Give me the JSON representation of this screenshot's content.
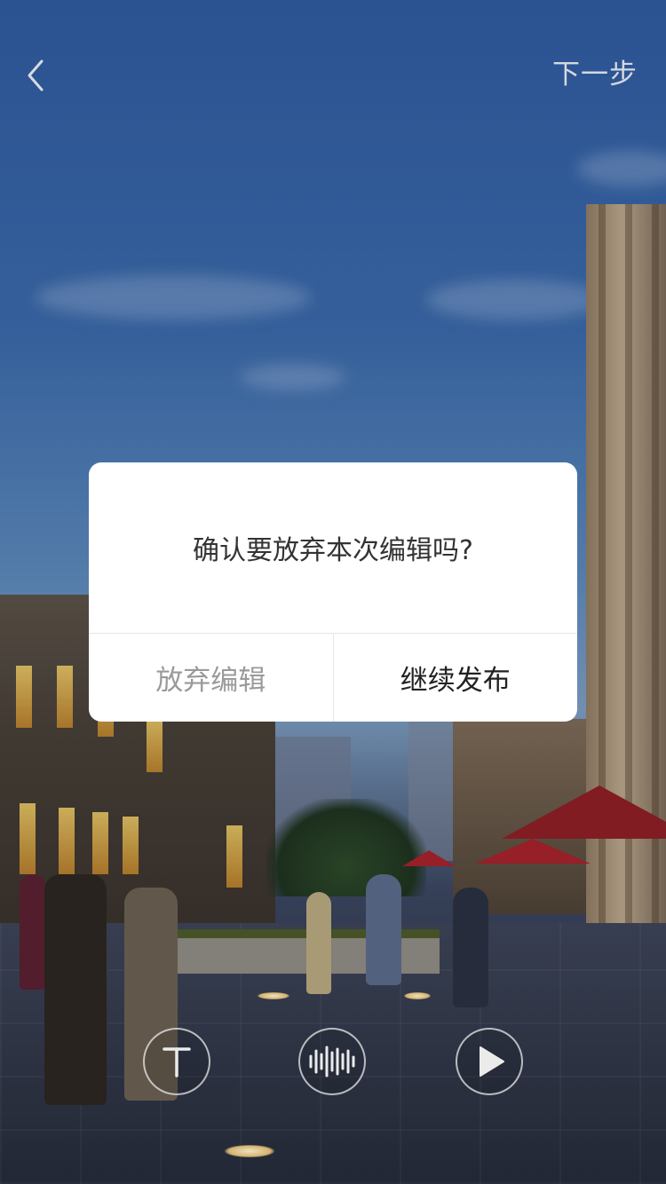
{
  "topbar": {
    "back_icon": "chevron-left-icon",
    "next_label": "下一步"
  },
  "tools": [
    {
      "icon": "text-icon"
    },
    {
      "icon": "audio-waveform-icon"
    },
    {
      "icon": "play-icon"
    }
  ],
  "dialog": {
    "message": "确认要放弃本次编辑吗?",
    "abandon_label": "放弃编辑",
    "continue_label": "继续发布"
  },
  "colors": {
    "dialog_bg": "#ffffff",
    "abandon_text": "#9a9a9a",
    "continue_text": "#222222"
  }
}
